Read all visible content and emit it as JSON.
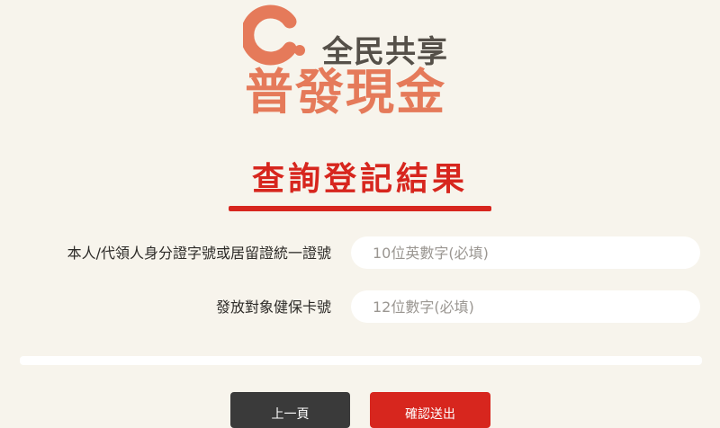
{
  "logo": {
    "tagline": "全民共享",
    "title": "普發現金"
  },
  "heading": {
    "title": "查詢登記結果"
  },
  "form": {
    "id_field": {
      "label": "本人/代領人身分證字號或居留證統一證號",
      "placeholder": "10位英數字(必填)"
    },
    "card_field": {
      "label": "發放對象健保卡號",
      "placeholder": "12位數字(必填)"
    }
  },
  "buttons": {
    "prev_label": "上一頁",
    "confirm_label": "確認送出"
  },
  "colors": {
    "background": "#f7f4ec",
    "brand_orange": "#e57a5a",
    "heading_red": "#d7261e",
    "tagline_gray": "#555049",
    "prev_button": "#3a3a3a",
    "confirm_button": "#d7261e"
  }
}
